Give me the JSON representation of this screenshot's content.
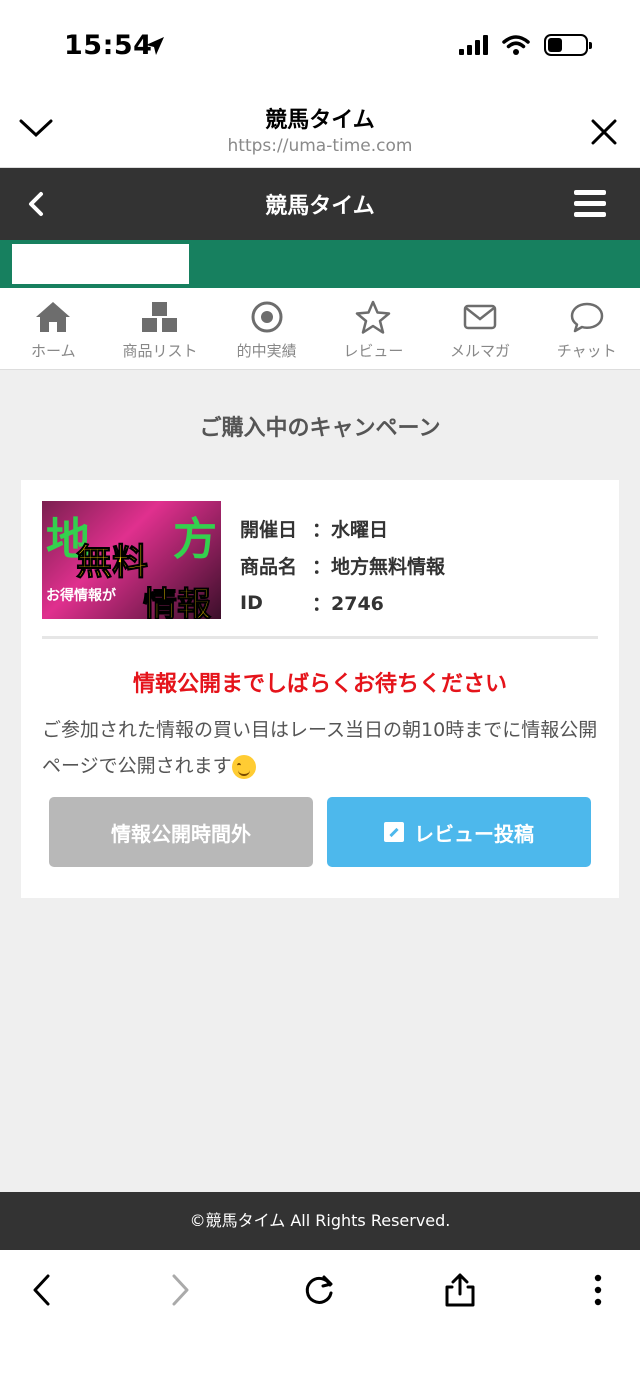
{
  "status": {
    "time": "15:54"
  },
  "browser": {
    "title": "競馬タイム",
    "url": "https://uma-time.com"
  },
  "site": {
    "title": "競馬タイム"
  },
  "nav": [
    {
      "label": "ホーム",
      "icon": "home-icon"
    },
    {
      "label": "商品リスト",
      "icon": "boxes-icon"
    },
    {
      "label": "的中実績",
      "icon": "target-icon"
    },
    {
      "label": "レビュー",
      "icon": "star-icon"
    },
    {
      "label": "メルマガ",
      "icon": "mail-icon"
    },
    {
      "label": "チャット",
      "icon": "chat-icon"
    }
  ],
  "page": {
    "heading": "ご購入中のキャンペーン"
  },
  "campaign": {
    "thumbnail": {
      "line1a": "地",
      "line1b": "方",
      "line2": "無料",
      "line3": "お得情報が",
      "line4": "情報"
    },
    "date_label": "開催日",
    "date_value": "：水曜日",
    "product_label": "商品名",
    "product_value": "：地方無料情報",
    "id_label": "ID",
    "id_value": "：2746",
    "notice": "情報公開までしばらくお待ちください",
    "description": "ご参加された情報の買い目はレース当日の朝10時までに情報公開ページで公開されます",
    "btn_closed": "情報公開時間外",
    "btn_review": "レビュー投稿"
  },
  "footer": {
    "copyright": "©競馬タイム All Rights Reserved."
  },
  "colors": {
    "green": "#17805f",
    "dark": "#333333",
    "red": "#e5141b",
    "blue": "#4db8ec",
    "gray": "#b8b8b8"
  }
}
